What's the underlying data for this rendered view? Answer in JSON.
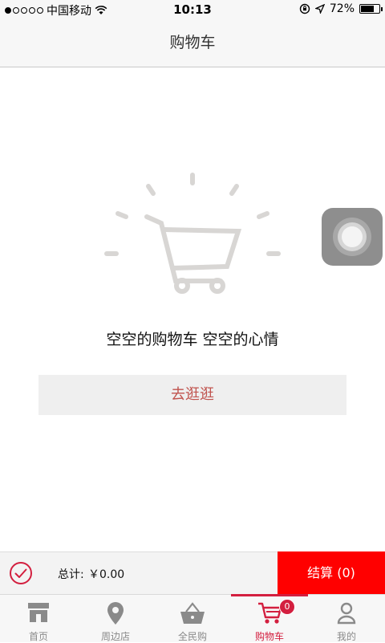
{
  "status_bar": {
    "carrier": "中国移动",
    "time": "10:13",
    "battery_percent": "72%",
    "battery_level": 0.72
  },
  "header": {
    "title": "购物车"
  },
  "empty_state": {
    "message": "空空的购物车 空空的心情",
    "button_label": "去逛逛"
  },
  "checkout": {
    "total_label": "总计:",
    "total_value": "￥0.00",
    "button_label": "结算 (0)"
  },
  "tabs": [
    {
      "label": "首页",
      "icon": "shop-icon"
    },
    {
      "label": "周边店",
      "icon": "location-pin-icon"
    },
    {
      "label": "全民购",
      "icon": "basket-icon"
    },
    {
      "label": "购物车",
      "icon": "cart-icon",
      "badge": "0",
      "active": true
    },
    {
      "label": "我的",
      "icon": "user-icon"
    }
  ],
  "colors": {
    "accent": "#d31f3f",
    "checkout_red": "#ff0000",
    "button_text": "#c0534e"
  }
}
